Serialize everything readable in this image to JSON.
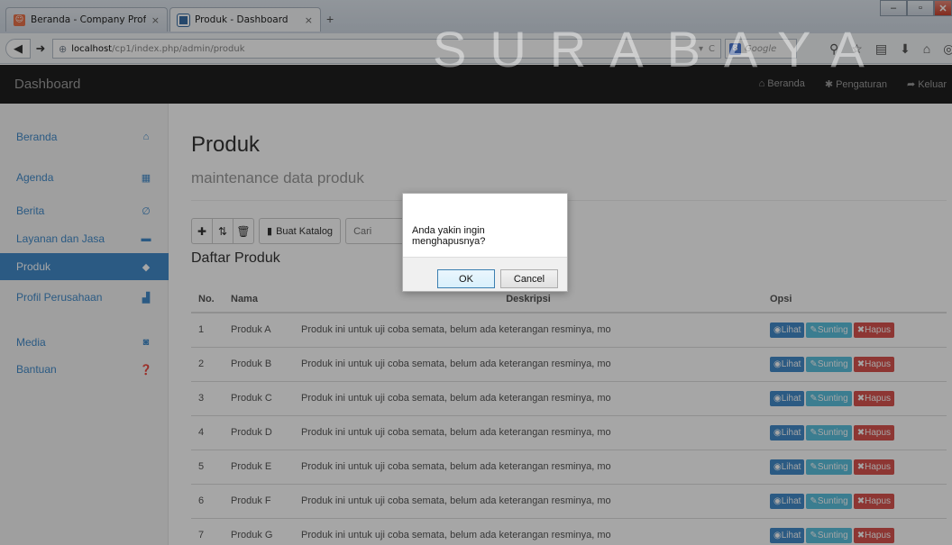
{
  "browser": {
    "tabs": [
      {
        "title": "Beranda - Company Profile",
        "close": "×"
      },
      {
        "title": "Produk - Dashboard",
        "close": "×"
      }
    ],
    "new_tab": "+",
    "url": {
      "host": "localhost",
      "path": "/cp1/index.php/admin/produk"
    },
    "search_placeholder": "Google",
    "window_controls": {
      "minimize": "–",
      "maximize": "▫",
      "close": "✕"
    }
  },
  "app": {
    "brand": "Dashboard",
    "top_nav": [
      {
        "label": "Beranda",
        "icon": "home-icon"
      },
      {
        "label": "Pengaturan",
        "icon": "gear-icon"
      },
      {
        "label": "Keluar",
        "icon": "logout-icon"
      }
    ]
  },
  "sidebar": {
    "items": [
      {
        "label": "Beranda",
        "icon": "home-icon"
      },
      {
        "label": "Agenda",
        "icon": "calendar-icon"
      },
      {
        "label": "Berita",
        "icon": "paperclip-icon"
      },
      {
        "label": "Layanan dan Jasa",
        "icon": "briefcase-icon"
      },
      {
        "label": "Produk",
        "icon": "tag-icon",
        "active": true
      },
      {
        "label": "Profil Perusahaan",
        "icon": "bar-chart-icon"
      },
      {
        "label": "Media",
        "icon": "camera-icon"
      },
      {
        "label": "Bantuan",
        "icon": "question-icon"
      }
    ]
  },
  "main": {
    "title": "Produk",
    "subtitle": "maintenance data produk",
    "toolbar": {
      "katalog_label": "Buat Katalog",
      "search_placeholder": "Cari"
    },
    "list_title": "Daftar Produk",
    "table": {
      "headers": [
        "No.",
        "Nama",
        "Deskripsi",
        "Opsi"
      ],
      "rows": [
        {
          "no": "1",
          "nama": "Produk A",
          "deskripsi": "Produk ini untuk uji coba semata, belum ada keterangan resminya, mo"
        },
        {
          "no": "2",
          "nama": "Produk B",
          "deskripsi": "Produk ini untuk uji coba semata, belum ada keterangan resminya, mo"
        },
        {
          "no": "3",
          "nama": "Produk C",
          "deskripsi": "Produk ini untuk uji coba semata, belum ada keterangan resminya, mo"
        },
        {
          "no": "4",
          "nama": "Produk D",
          "deskripsi": "Produk ini untuk uji coba semata, belum ada keterangan resminya, mo"
        },
        {
          "no": "5",
          "nama": "Produk E",
          "deskripsi": "Produk ini untuk uji coba semata, belum ada keterangan resminya, mo"
        },
        {
          "no": "6",
          "nama": "Produk F",
          "deskripsi": "Produk ini untuk uji coba semata, belum ada keterangan resminya, mo"
        },
        {
          "no": "7",
          "nama": "Produk G",
          "deskripsi": "Produk ini untuk uji coba semata, belum ada keterangan resminya, mo"
        }
      ],
      "actions": {
        "view": "Lihat",
        "edit": "Sunting",
        "delete": "Hapus"
      }
    }
  },
  "dialog": {
    "message": "Anda yakin ingin menghapusnya?",
    "ok_label": "OK",
    "cancel_label": "Cancel"
  },
  "watermark": "SURABAYA",
  "colors": {
    "primary": "#428bca",
    "info": "#5bc0de",
    "danger": "#d9534f",
    "header_bg": "#1f1f1f"
  }
}
